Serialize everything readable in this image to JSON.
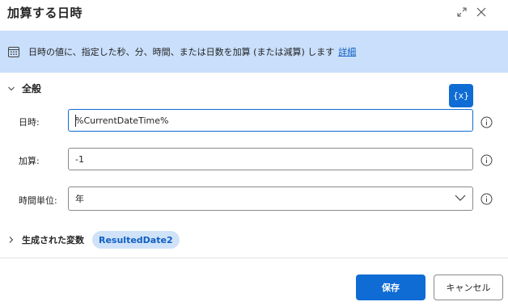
{
  "dialog": {
    "title": "加算する日時"
  },
  "banner": {
    "text": "日時の値に、指定した秒、分、時間、または日数を加算 (または減算) します",
    "link": "詳細"
  },
  "general": {
    "label": "全般",
    "variable_button": "{x}"
  },
  "fields": {
    "datetime": {
      "label": "日時:",
      "value": "%CurrentDateTime%"
    },
    "add": {
      "label": "加算:",
      "value": "-1"
    },
    "unit": {
      "label": "時間単位:",
      "value": "年"
    }
  },
  "produced": {
    "label": "生成された変数",
    "variable": "ResultedDate2"
  },
  "buttons": {
    "save": "保存",
    "cancel": "キャンセル"
  },
  "colors": {
    "accent": "#0f6cd4",
    "banner_bg": "#c9dffb",
    "chip_bg": "#cfe2f8"
  },
  "icons": [
    "expand-icon",
    "close-icon",
    "calendar-icon",
    "chevron-down-icon",
    "chevron-right-icon",
    "info-icon"
  ]
}
